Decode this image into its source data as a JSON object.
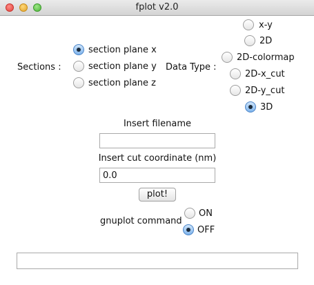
{
  "window": {
    "title": "fplot v2.0"
  },
  "sections": {
    "label": "Sections :",
    "options": [
      "section plane x",
      "section plane y",
      "section plane z"
    ],
    "selected": "section plane x"
  },
  "data_type": {
    "label": "Data Type :",
    "options": [
      "x-y",
      "2D",
      "2D-colormap",
      "2D-x_cut",
      "2D-y_cut",
      "3D"
    ],
    "selected": "3D"
  },
  "filename": {
    "label": "Insert filename",
    "value": ""
  },
  "cut": {
    "label": "Insert cut coordinate (nm)",
    "value": "0.0"
  },
  "plot_button": "plot!",
  "gnuplot": {
    "label": "gnuplot command",
    "options": [
      "ON",
      "OFF"
    ],
    "selected": "OFF"
  },
  "status": {
    "value": ""
  }
}
